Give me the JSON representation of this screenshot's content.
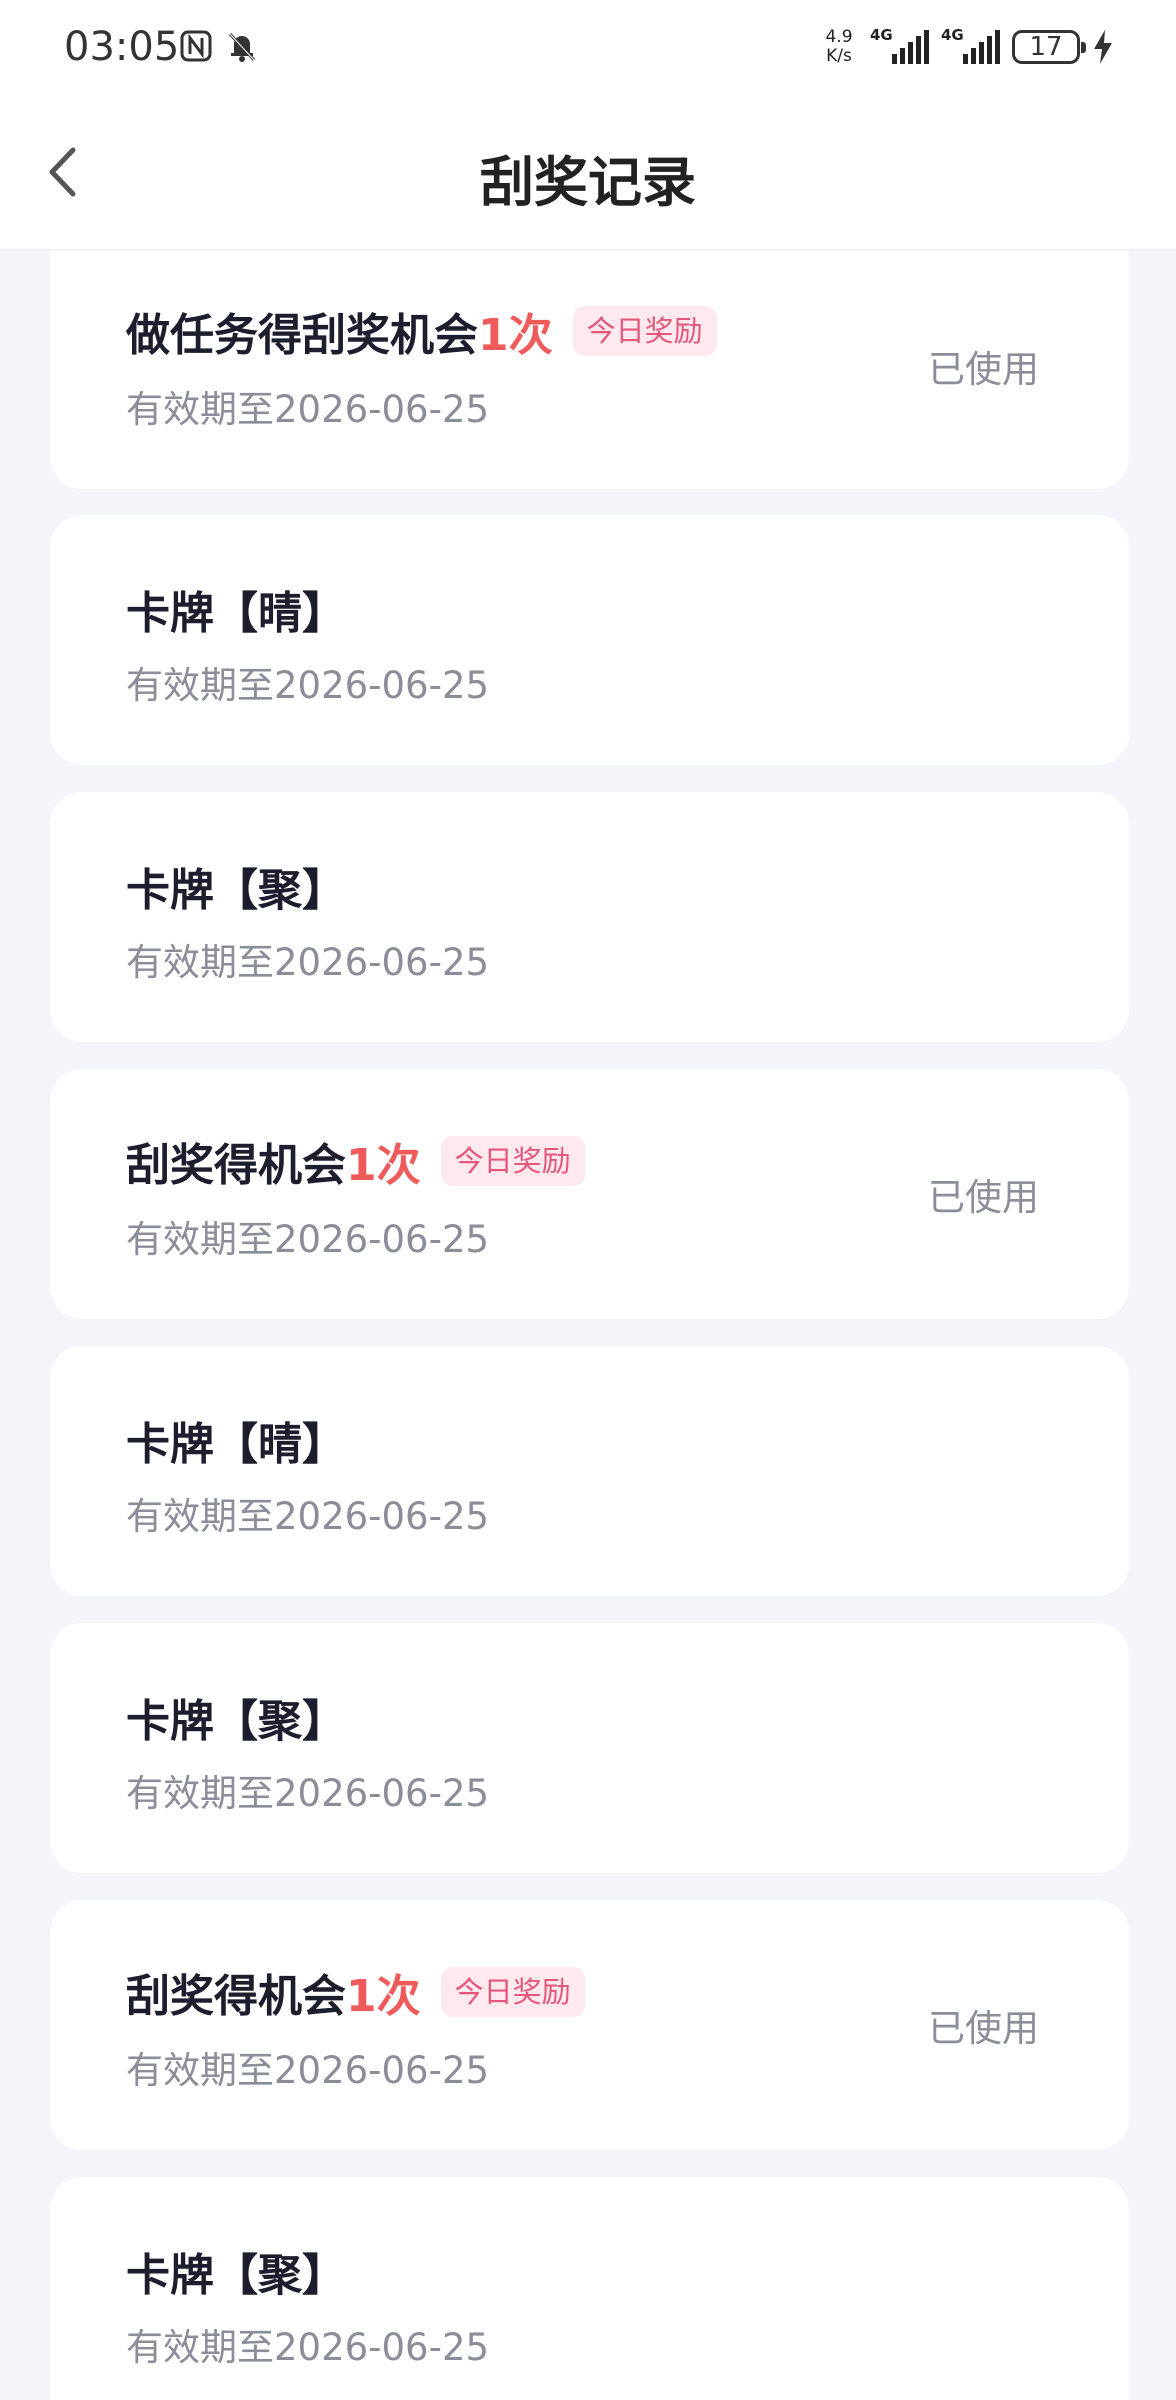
{
  "status_bar": {
    "time": "03:05",
    "net_speed_value": "4.9",
    "net_speed_unit": "K/s",
    "sim1_label": "4G",
    "sim2_label": "4G",
    "battery_level": "17",
    "icons": [
      "nfc-icon",
      "mute-bell-icon",
      "charging-bolt-icon"
    ]
  },
  "header": {
    "title": "刮奖记录",
    "back_icon": "chevron-left-icon"
  },
  "records": [
    {
      "title": "做任务得刮奖机会",
      "count": "1次",
      "tag": "今日奖励",
      "expiry": "有效期至2026-06-25",
      "status": "已使用"
    },
    {
      "title": "卡牌【晴】",
      "count": "",
      "tag": "",
      "expiry": "有效期至2026-06-25",
      "status": ""
    },
    {
      "title": "卡牌【聚】",
      "count": "",
      "tag": "",
      "expiry": "有效期至2026-06-25",
      "status": ""
    },
    {
      "title": "刮奖得机会",
      "count": "1次",
      "tag": "今日奖励",
      "expiry": "有效期至2026-06-25",
      "status": "已使用"
    },
    {
      "title": "卡牌【晴】",
      "count": "",
      "tag": "",
      "expiry": "有效期至2026-06-25",
      "status": ""
    },
    {
      "title": "卡牌【聚】",
      "count": "",
      "tag": "",
      "expiry": "有效期至2026-06-25",
      "status": ""
    },
    {
      "title": "刮奖得机会",
      "count": "1次",
      "tag": "今日奖励",
      "expiry": "有效期至2026-06-25",
      "status": "已使用"
    },
    {
      "title": "卡牌【聚】",
      "count": "",
      "tag": "",
      "expiry": "有效期至2026-06-25",
      "status": ""
    }
  ],
  "colors": {
    "page_bg": "#f4f5fa",
    "card_bg": "#ffffff",
    "title_text": "#1c1e2e",
    "count_red": "#ef5b5b",
    "tag_bg": "#fde9ee",
    "tag_text": "#e5577a",
    "secondary_text": "#8b8d98"
  }
}
